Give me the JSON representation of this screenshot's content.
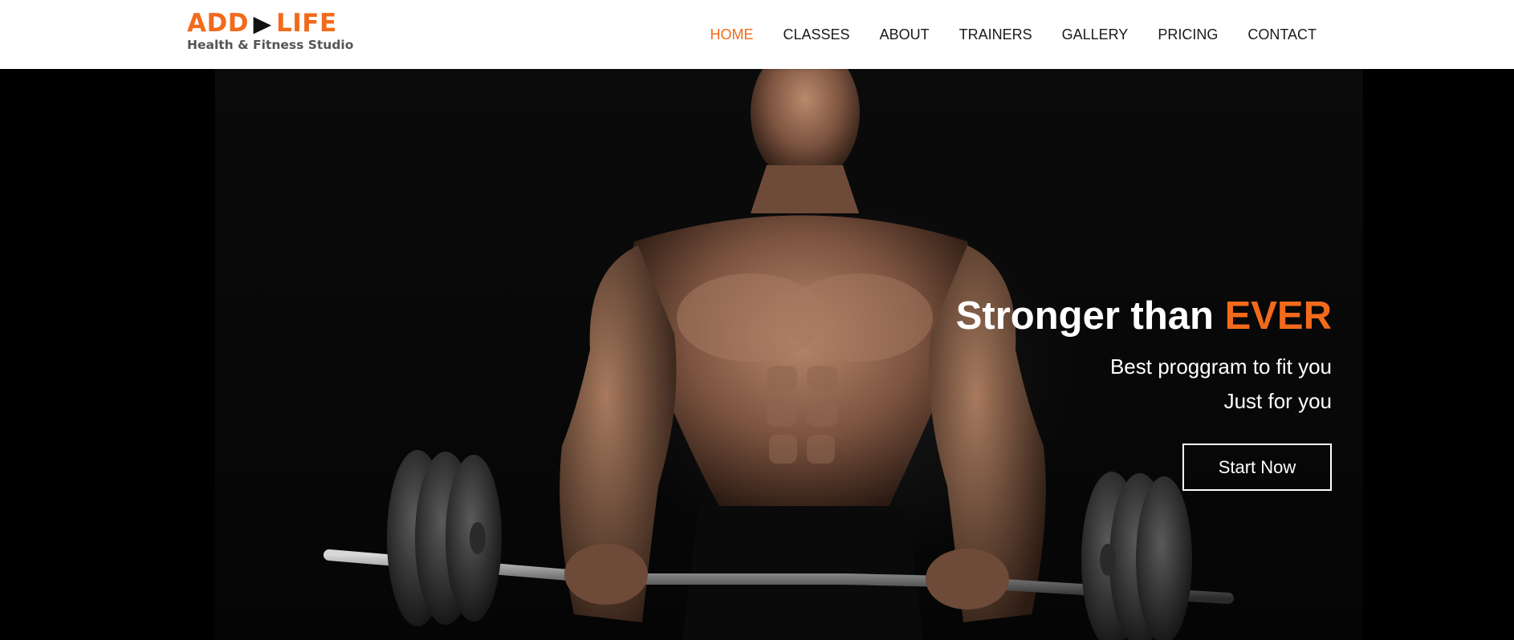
{
  "brand": {
    "name_left": "ADD",
    "name_right": "LIFE",
    "arrow_glyph": "▶",
    "tagline": "Health & Fitness Studio",
    "accent_color": "#f26a1b"
  },
  "nav": {
    "items": [
      {
        "label": "HOME",
        "active": true
      },
      {
        "label": "CLASSES",
        "active": false
      },
      {
        "label": "ABOUT",
        "active": false
      },
      {
        "label": "TRAINERS",
        "active": false
      },
      {
        "label": "GALLERY",
        "active": false
      },
      {
        "label": "PRICING",
        "active": false
      },
      {
        "label": "CONTACT",
        "active": false
      }
    ]
  },
  "hero": {
    "headline_main": "Stronger than ",
    "headline_accent": "EVER",
    "sub_line_1": "Best proggram to fit you",
    "sub_line_2": "Just for you",
    "cta_label": "Start Now",
    "background_color": "#000000",
    "text_color": "#ffffff"
  }
}
